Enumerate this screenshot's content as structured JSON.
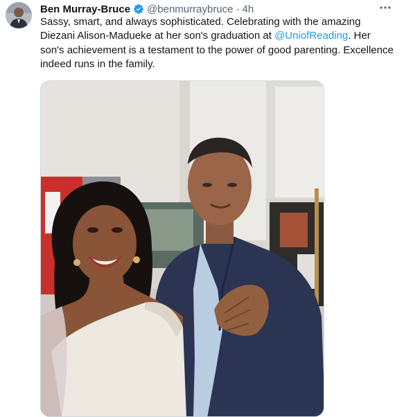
{
  "tweet": {
    "author_name": "Ben Murray-Bruce",
    "handle": "@benmurraybruce",
    "separator": "·",
    "time": "4h",
    "text_before": "Sassy, smart, and always sophisticated. Celebrating with the amazing Diezani Alison-Madueke at her son's graduation at ",
    "mention": "@UniofReading",
    "text_after": ". Her son's achievement is a testament to the power of good parenting. Excellence indeed runs in the family."
  },
  "icons": {
    "verified": "verified-badge-icon",
    "more": "more-options-icon"
  },
  "colors": {
    "accent": "#1d9bf0",
    "text": "#0f1419",
    "secondary": "#536471"
  }
}
